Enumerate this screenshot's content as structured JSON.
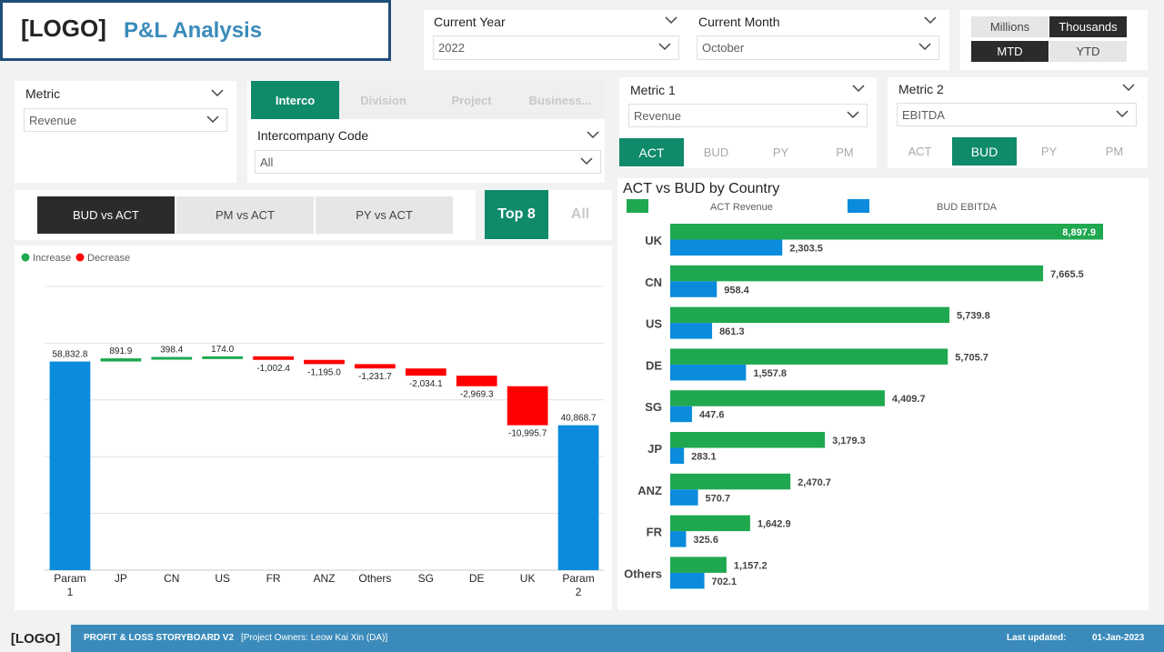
{
  "header": {
    "logo": "[LOGO]",
    "title": "P&L Analysis"
  },
  "current_year": {
    "label": "Current Year",
    "value": "2022"
  },
  "current_month": {
    "label": "Current Month",
    "value": "October"
  },
  "units": {
    "options": [
      "Millions",
      "Thousands"
    ],
    "selected": "Thousands"
  },
  "period": {
    "options": [
      "MTD",
      "YTD"
    ],
    "selected": "MTD"
  },
  "metric": {
    "label": "Metric",
    "value": "Revenue"
  },
  "dimension_tabs": {
    "items": [
      "Interco",
      "Division",
      "Project",
      "Business..."
    ],
    "selected": "Interco"
  },
  "intercompany": {
    "label": "Intercompany Code",
    "value": "All"
  },
  "metric1": {
    "label": "Metric 1",
    "value": "Revenue",
    "tabs": [
      "ACT",
      "BUD",
      "PY",
      "PM"
    ],
    "selected": "ACT"
  },
  "metric2": {
    "label": "Metric 2",
    "value": "EBITDA",
    "tabs": [
      "ACT",
      "BUD",
      "PY",
      "PM"
    ],
    "selected": "BUD"
  },
  "compare_tabs": {
    "items": [
      "BUD vs ACT",
      "PM vs ACT",
      "PY vs ACT"
    ],
    "selected": "BUD vs ACT"
  },
  "topn": {
    "items": [
      "Top 8",
      "All"
    ],
    "selected": "Top 8"
  },
  "colors": {
    "green": "#1fa84f",
    "blue": "#0a8bdc",
    "red": "#ff0000",
    "teal": "#0f8a6b",
    "footer": "#3a8bbb"
  },
  "chart_data": [
    {
      "type": "waterfall",
      "legend": [
        {
          "name": "Increase",
          "color": "#1fa84f"
        },
        {
          "name": "Decrease",
          "color": "#ff0000"
        }
      ],
      "categories": [
        "Param 1",
        "JP",
        "CN",
        "US",
        "FR",
        "ANZ",
        "Others",
        "SG",
        "DE",
        "UK",
        "Param 2"
      ],
      "values": [
        58832.8,
        891.9,
        398.4,
        174.0,
        -1002.4,
        -1195.0,
        -1231.7,
        -2034.1,
        -2969.3,
        -10995.7,
        40868.7
      ],
      "labels": [
        "58,832.8",
        "891.9",
        "398.4",
        "174.0",
        "-1,002.4",
        "-1,195.0",
        "-1,231.7",
        "-2,034.1",
        "-2,969.3",
        "-10,995.7",
        "40,868.7"
      ],
      "kinds": [
        "total",
        "delta",
        "delta",
        "delta",
        "delta",
        "delta",
        "delta",
        "delta",
        "delta",
        "delta",
        "total"
      ],
      "ylim": [
        0,
        80000
      ],
      "grid": true
    },
    {
      "type": "bar",
      "orientation": "horizontal",
      "title": "ACT vs BUD by Country",
      "categories": [
        "UK",
        "CN",
        "US",
        "DE",
        "SG",
        "JP",
        "ANZ",
        "FR",
        "Others"
      ],
      "series": [
        {
          "name": "ACT Revenue",
          "color": "#1fa84f",
          "values": [
            8897.9,
            7665.5,
            5739.8,
            5705.7,
            4409.7,
            3179.3,
            2470.7,
            1642.9,
            1157.2
          ],
          "labels": [
            "8,897.9",
            "7,665.5",
            "5,739.8",
            "5,705.7",
            "4,409.7",
            "3,179.3",
            "2,470.7",
            "1,642.9",
            "1,157.2"
          ]
        },
        {
          "name": "BUD EBITDA",
          "color": "#0a8bdc",
          "values": [
            2303.5,
            958.4,
            861.3,
            1557.8,
            447.6,
            283.1,
            570.7,
            325.6,
            702.1
          ],
          "labels": [
            "2,303.5",
            "958.4",
            "861.3",
            "1,557.8",
            "447.6",
            "283.1",
            "570.7",
            "325.6",
            "702.1"
          ]
        }
      ],
      "xlim": [
        0,
        8897.9
      ]
    }
  ],
  "footer": {
    "logo": "[LOGO]",
    "title": "PROFIT & LOSS STORYBOARD V2",
    "owners": "[Project Owners: Leow Kai Xin (DA)]",
    "updated_label": "Last updated:",
    "updated_value": "01-Jan-2023"
  }
}
